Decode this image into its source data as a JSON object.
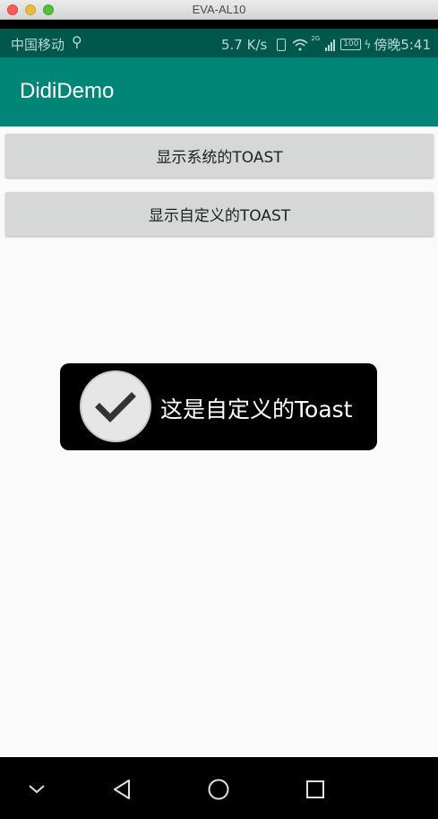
{
  "window": {
    "title": "EVA-AL10"
  },
  "status_bar": {
    "carrier": "中国移动",
    "usb_icon": "usb-icon",
    "net_speed": "5.7 K/s",
    "signal_label": "2G",
    "battery": "100",
    "time": "傍晚5:41",
    "color": "#00574b"
  },
  "app_bar": {
    "title": "DidiDemo",
    "color": "#008577"
  },
  "buttons": {
    "system_toast": "显示系统的TOAST",
    "custom_toast": "显示自定义的TOAST"
  },
  "toast": {
    "text": "这是自定义的Toast",
    "icon": "checkmark-icon"
  },
  "nav_bar": {
    "items": [
      "chevron-down-icon",
      "back-icon",
      "home-icon",
      "recents-icon"
    ]
  }
}
